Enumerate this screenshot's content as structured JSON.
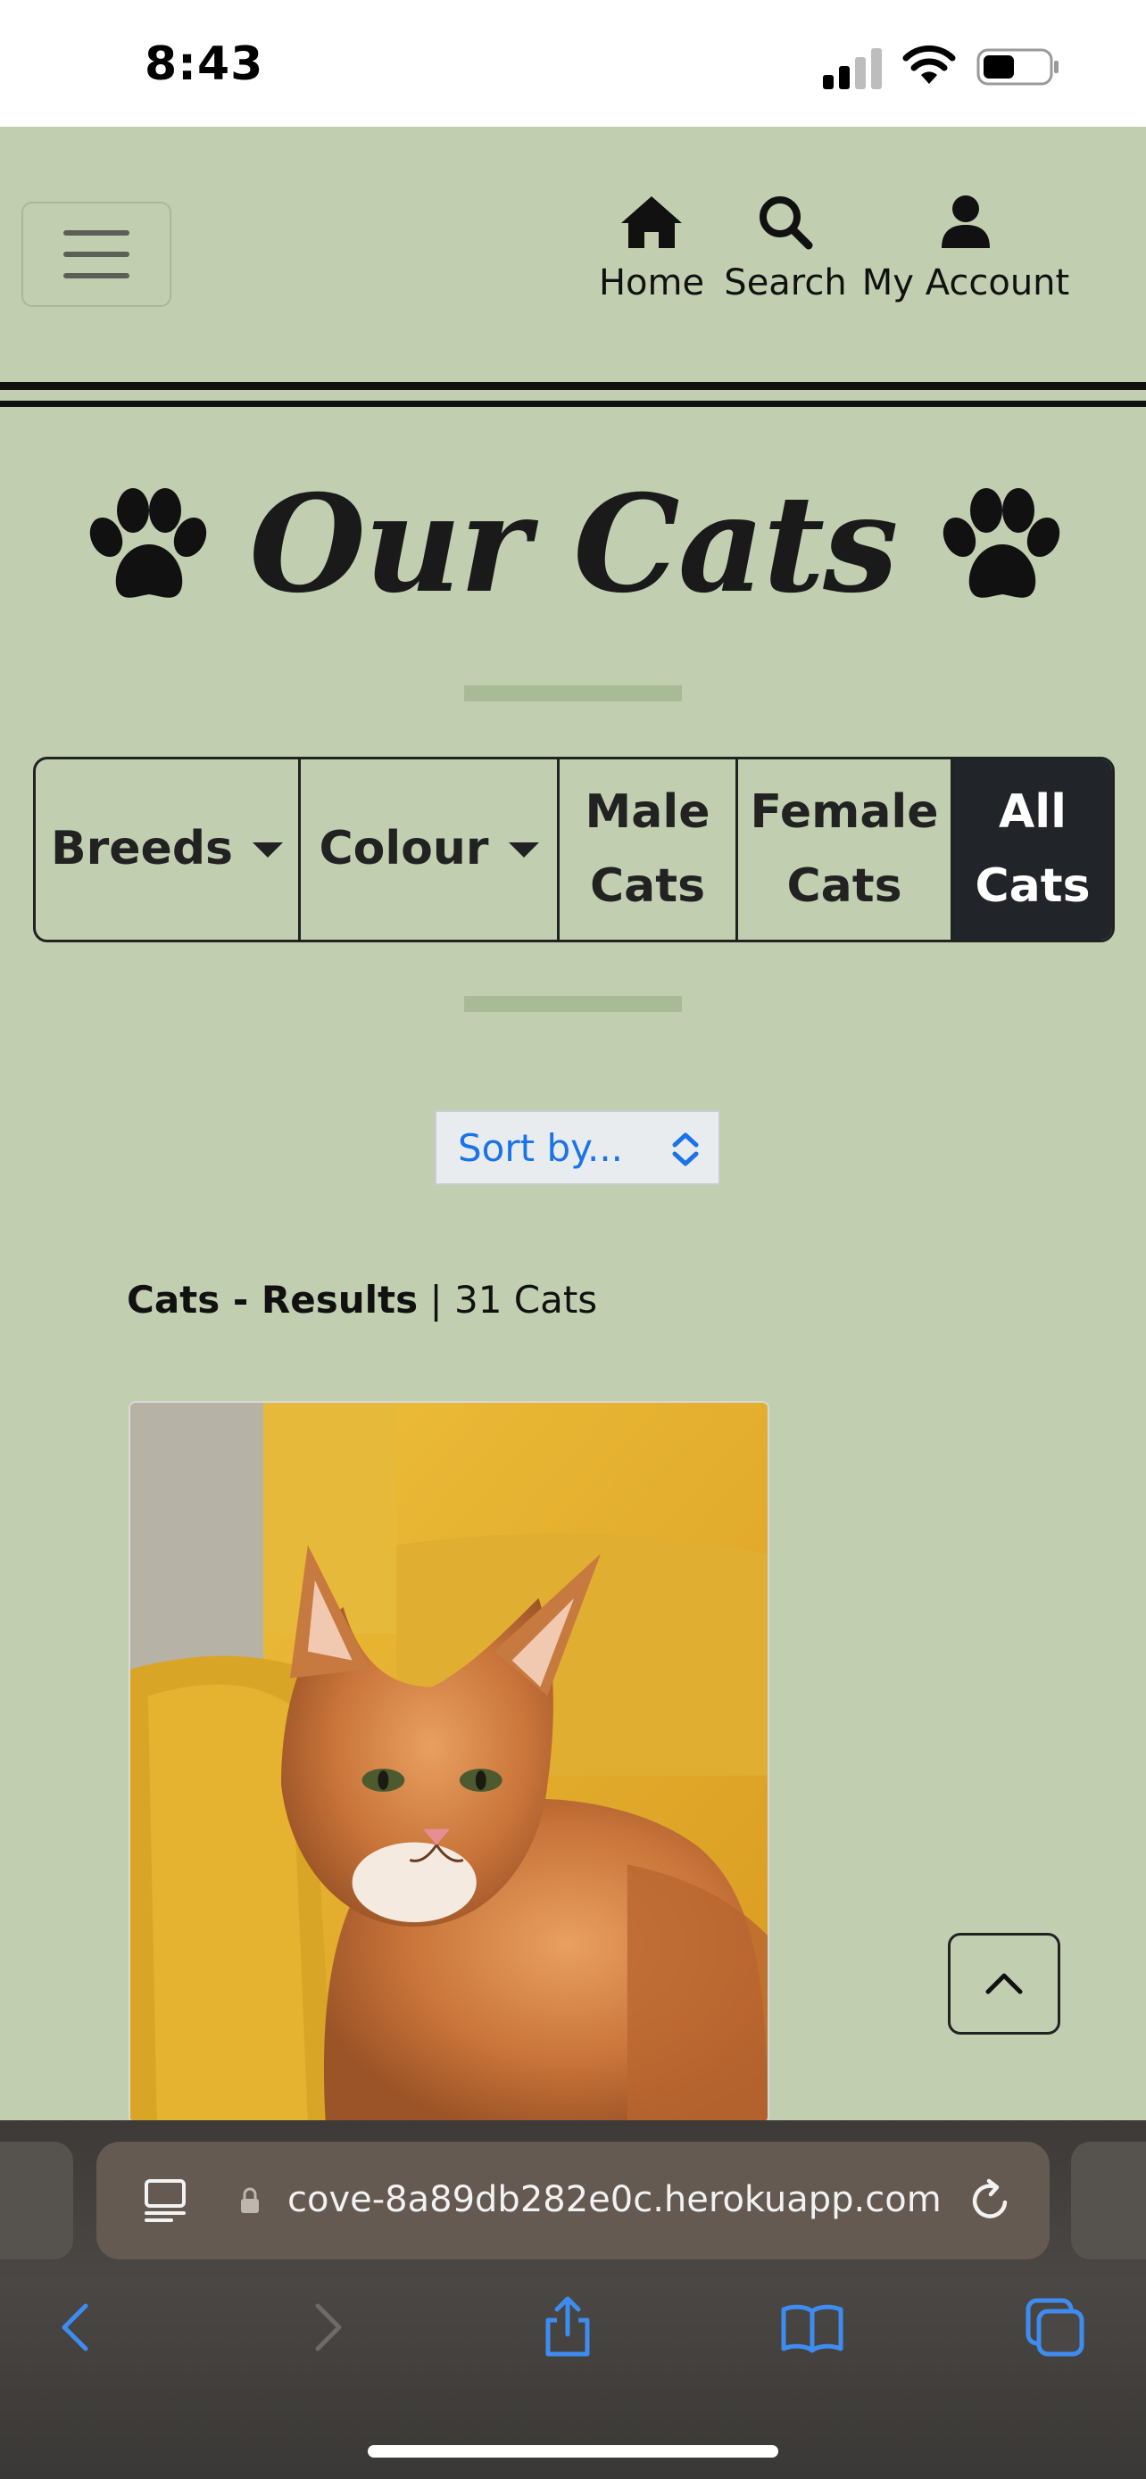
{
  "status_bar": {
    "time": "8:43"
  },
  "nav": {
    "home_label": "Home",
    "search_label": "Search",
    "account_label": "My Account"
  },
  "page": {
    "title": "Our Cats"
  },
  "filters": {
    "breeds": "Breeds",
    "colour": "Colour",
    "male_line1": "Male",
    "male_line2": "Cats",
    "female_line1": "Female",
    "female_line2": "Cats",
    "all_line1": "All",
    "all_line2": "Cats",
    "active": "All Cats"
  },
  "sort": {
    "placeholder": "Sort by..."
  },
  "results": {
    "heading": "Cats - Results",
    "separator": " | ",
    "count_text": "31 Cats"
  },
  "browser": {
    "url": "cove-8a89db282e0c.herokuapp.com"
  },
  "colors": {
    "page_background": "#c1cfb0",
    "accent_divider": "#a9bb96",
    "active_filter": "#212529",
    "link_blue": "#1a73e8"
  }
}
